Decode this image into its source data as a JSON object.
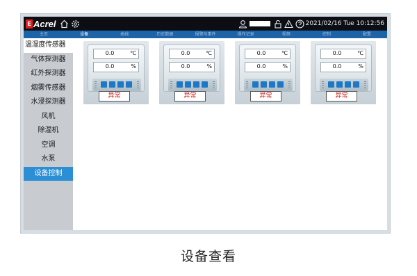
{
  "app": {
    "logo_mark": "E",
    "logo_text": "Acrel",
    "datetime": "2021/02/16 Tue 10:12:56"
  },
  "menu": [
    {
      "label": "主页",
      "active": false
    },
    {
      "label": "设备",
      "active": true
    },
    {
      "label": "曲线",
      "active": false
    },
    {
      "label": "历史数据",
      "active": false
    },
    {
      "label": "报警与事件",
      "active": false
    },
    {
      "label": "操作记录",
      "active": false
    },
    {
      "label": "视频",
      "active": false
    },
    {
      "label": "控制",
      "active": false
    },
    {
      "label": "配置",
      "active": false
    }
  ],
  "sidebar": {
    "items": [
      {
        "label": "温湿度传感器"
      },
      {
        "label": "气体探测器"
      },
      {
        "label": "红外探测器"
      },
      {
        "label": "烟雾传感器"
      },
      {
        "label": "水浸探测器"
      },
      {
        "label": "风机"
      },
      {
        "label": "除湿机"
      },
      {
        "label": "空调"
      },
      {
        "label": "水泵"
      },
      {
        "label": "设备控制"
      }
    ]
  },
  "devices": [
    {
      "temp": "0.0",
      "temp_unit": "℃",
      "hum": "0.0",
      "hum_unit": "%",
      "status": "异常"
    },
    {
      "temp": "0.0",
      "temp_unit": "℃",
      "hum": "0.0",
      "hum_unit": "%",
      "status": "异常"
    },
    {
      "temp": "0.0",
      "temp_unit": "℃",
      "hum": "0.0",
      "hum_unit": "%",
      "status": "异常"
    },
    {
      "temp": "0.0",
      "temp_unit": "℃",
      "hum": "0.0",
      "hum_unit": "%",
      "status": "异常"
    }
  ],
  "icons": [
    "home-icon",
    "settings-icon",
    "user-icon",
    "lock-icon",
    "warning-icon",
    "help-icon"
  ],
  "colors": {
    "topbar": "#0c0e14",
    "menubar": "#1d63a8",
    "sidebar_active": "#2c8fd6",
    "status_text": "#d62020"
  },
  "caption": "设备查看"
}
